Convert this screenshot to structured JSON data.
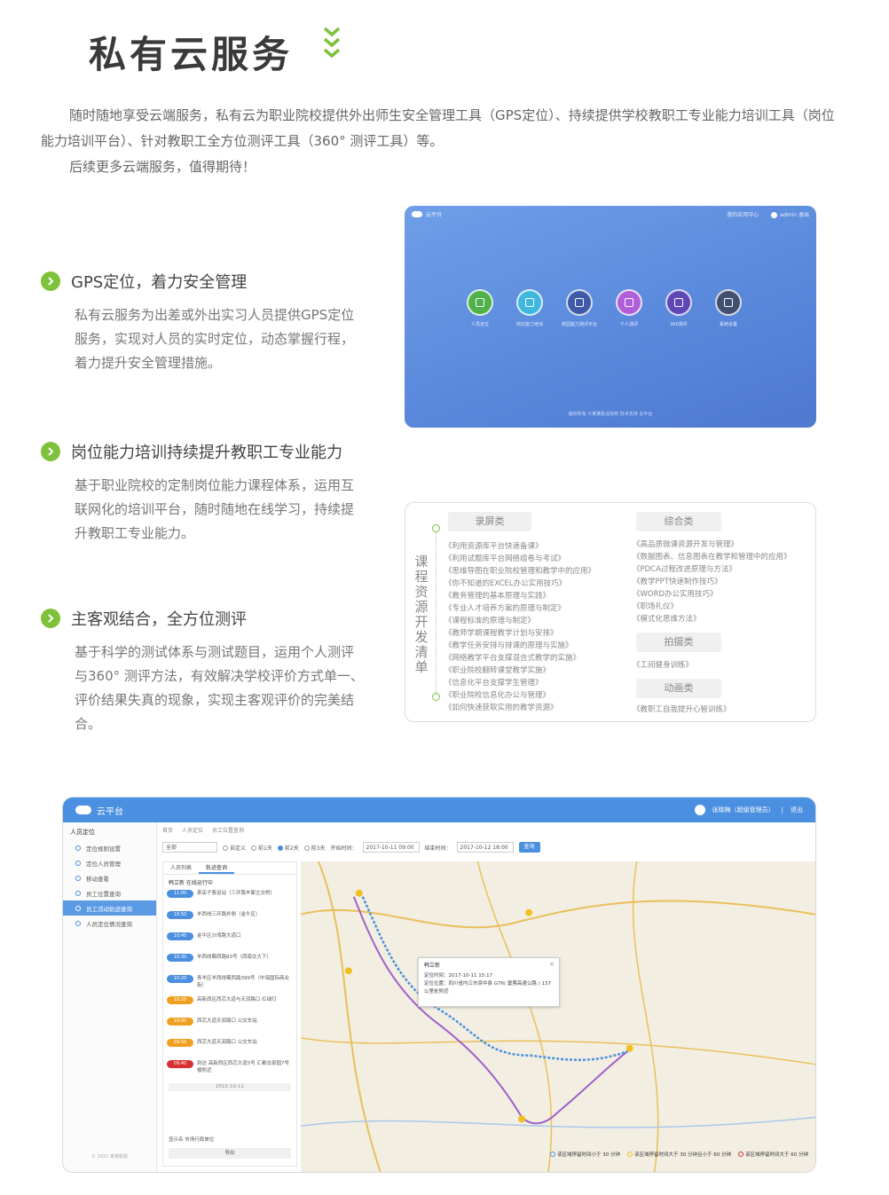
{
  "header": {
    "title": "私有云服务"
  },
  "intro": [
    "随时随地享受云端服务，私有云为职业院校提供外出师生安全管理工具（GPS定位）、持续提供学校教职工专业能力培训工具（岗位能力培训平台）、针对教职工全方位测评工具（360° 测评工具）等。",
    "后续更多云端服务，值得期待！"
  ],
  "features": [
    {
      "title": "GPS定位，着力安全管理",
      "body": "私有云服务为出差或外出实习人员提供GPS定位服务，实现对人员的实时定位，动态掌握行程，着力提升安全管理措施。"
    },
    {
      "title": "岗位能力培训持续提升教职工专业能力",
      "body": "基于职业院校的定制岗位能力课程体系，运用互联网化的培训平台，随时随地在线学习，持续提升教职工专业能力。"
    },
    {
      "title": "主客观结合，全方位测评",
      "body": "基于科学的测试体系与测试题目，运用个人测评与360° 测评方法，有效解决学校评价方式单一、评价结果失真的现象，实现主客观评价的完美结合。"
    }
  ],
  "portal": {
    "brand": "云平台",
    "top_right": [
      "我的应用中心",
      "admin 退出"
    ],
    "apps": [
      "人员定位",
      "岗位能力培训",
      "校园能力测评平台",
      "个人测评",
      "360测评",
      "系统设置"
    ],
    "footer": "版权所有 ©某某职业院校 技术支持 云平台"
  },
  "resources": {
    "vertical_title": "课程资源开发清单",
    "cat1": "录屏类",
    "cat1_items": [
      "《利用资源库平台快速备课》",
      "《利用试题库平台网络组卷与考试》",
      "《思维导图在职业院校管理和教学中的应用》",
      "《你不知道的EXCEL办公实用技巧》",
      "《教务管理的基本原理与实践》",
      "《专业人才培养方案的原理与制定》",
      "《课程标准的原理与制定》",
      "《教师学期课程教学计划与安排》",
      "《教学任务安排与排课的原理与实施》",
      "《网络教学平台支撑混合式教学的实施》",
      "《职业院校翻转课堂教学实施》",
      "《信息化平台支撑学生管理》",
      "《职业院校信息化办公与管理》",
      "《如何快速获取实用的教学资源》"
    ],
    "cat2": "综合类",
    "cat2_items": [
      "《高品质微课资源开发与管理》",
      "《数据图表、信息图表在教学和管理中的应用》",
      "《PDCA过程改进原理与方法》",
      "《教学PPT快速制作技巧》",
      "《WORD办公实用技巧》",
      "《职场礼仪》",
      "《模式化思维方法》"
    ],
    "cat3": "拍摄类",
    "cat3_items": [
      "《工间健身训练》"
    ],
    "cat4": "动画类",
    "cat4_items": [
      "《教职工自我提升心智训练》"
    ]
  },
  "tracking": {
    "brand": "云平台",
    "user": "张晓梅（超级管理员）",
    "logout": "退出",
    "menu_header": "人员定位",
    "menu": [
      "定位规则设置",
      "定位人员管理",
      "移动查看",
      "员工位置查询",
      "员工活动轨迹查询",
      "人员定位情况查询"
    ],
    "menu_active": 4,
    "footer": "© 2015 某某职院",
    "crumbs": [
      "首页",
      "人员定位",
      "员工位置查询"
    ],
    "filter": {
      "select": "全部",
      "radios": [
        "自定义",
        "前1天",
        "前2天",
        "前3天"
      ],
      "radio_on": 2,
      "start_label": "开始时间：",
      "start": "2017-10-11 09:00",
      "end_label": "结束时间：",
      "end": "2017-10-12 18:00",
      "search": "查询"
    },
    "tabs": [
      "人员列表",
      "轨迹查询"
    ],
    "person": "韩立新 在线运行中",
    "events": [
      {
        "time": "11:00",
        "text": "茶店子客运站（三环路羊犀立交桥）",
        "color": "#4a8fe0"
      },
      {
        "time": "10:50",
        "text": "羊西线三环路外侧（金牛区）",
        "color": "#4a8fe0"
      },
      {
        "time": "10:45",
        "text": "金牛区沙湾路大道口",
        "color": "#4a8fe0"
      },
      {
        "time": "10:30",
        "text": "羊西线蜀西路83号（西南交大下）",
        "color": "#4a8fe0"
      },
      {
        "time": "10:20",
        "text": "青羊区羊西线蜀西路399号（中海国际商业街）",
        "color": "#4a8fe0"
      },
      {
        "time": "10:10",
        "text": "高新西区西芯大道与天润路口 红绿灯",
        "color": "#f0a020"
      },
      {
        "time": "10:00",
        "text": "西芯大道天润路口 公交车站",
        "color": "#f0a020"
      },
      {
        "time": "09:50",
        "text": "西芯大道天润路口 公交车站",
        "color": "#f0a020"
      },
      {
        "time": "09:40",
        "text": "到达 高新西区西芯大道5号 汇都总部园7号楼附近",
        "color": "#d83030"
      }
    ],
    "date": "2015-10-11",
    "footer1": "显示名 市场行政单位",
    "export": "导出",
    "popup": {
      "name": "韩立新",
      "time": "定位时间：2017-10-11 15:17",
      "addr": "定位位置：四川省内江市资中县 G76( 厦蓉高速公路 ) 137 公里处附近"
    },
    "legend": [
      "该区域停留时间小于 30 分钟",
      "该区域停留时间大于 30 分钟且小于 60 分钟",
      "该区域停留时间大于 60 分钟"
    ],
    "legend_colors": [
      "#4a8fe0",
      "#f0c020",
      "#d83030"
    ]
  }
}
